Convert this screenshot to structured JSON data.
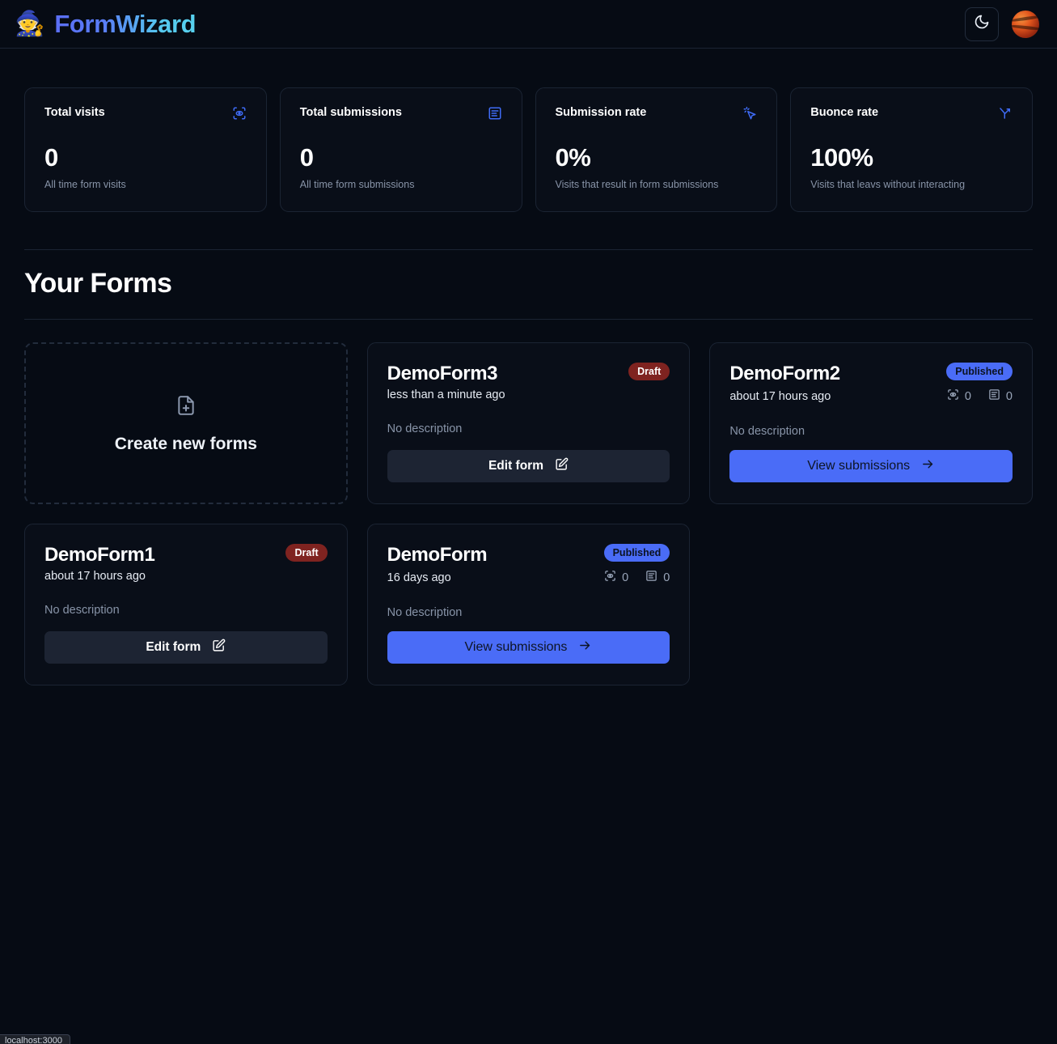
{
  "header": {
    "logo_emoji": "🧙",
    "brand": "FormWizard",
    "theme_toggle_icon": "moon-icon",
    "avatar_label": "user-avatar"
  },
  "stats": [
    {
      "title": "Total visits",
      "value": "0",
      "subtitle": "All time form visits",
      "icon": "eye-scan-icon"
    },
    {
      "title": "Total submissions",
      "value": "0",
      "subtitle": "All time form submissions",
      "icon": "form-input-icon"
    },
    {
      "title": "Submission rate",
      "value": "0%",
      "subtitle": "Visits that result in form submissions",
      "icon": "mouse-pointer-click-icon"
    },
    {
      "title": "Buonce rate",
      "value": "100%",
      "subtitle": "Visits that leavs without interacting",
      "icon": "arrow-branch-icon"
    }
  ],
  "section": {
    "title": "Your Forms"
  },
  "create_card": {
    "label": "Create new forms",
    "icon": "file-plus-icon"
  },
  "forms": [
    {
      "name": "DemoForm3",
      "badge": "Draft",
      "badge_type": "draft",
      "date": "less than a minute ago",
      "description": "No description",
      "action_label": "Edit form",
      "action_type": "secondary",
      "action_icon": "pencil-square-icon",
      "show_stats": false,
      "visits": "",
      "submissions": ""
    },
    {
      "name": "DemoForm2",
      "badge": "Published",
      "badge_type": "published",
      "date": "about 17 hours ago",
      "description": "No description",
      "action_label": "View submissions",
      "action_type": "primary",
      "action_icon": "arrow-right-icon",
      "show_stats": true,
      "visits": "0",
      "submissions": "0"
    },
    {
      "name": "DemoForm1",
      "badge": "Draft",
      "badge_type": "draft",
      "date": "about 17 hours ago",
      "description": "No description",
      "action_label": "Edit form",
      "action_type": "secondary",
      "action_icon": "pencil-square-icon",
      "show_stats": false,
      "visits": "",
      "submissions": ""
    },
    {
      "name": "DemoForm",
      "badge": "Published",
      "badge_type": "published",
      "date": "16 days ago",
      "description": "No description",
      "action_label": "View submissions",
      "action_type": "primary",
      "action_icon": "arrow-right-icon",
      "show_stats": true,
      "visits": "0",
      "submissions": "0"
    }
  ],
  "status_bar": {
    "text": "localhost:3000"
  },
  "colors": {
    "background": "#060b14",
    "card": "#090e18",
    "border": "#1b2433",
    "accent": "#4a6cf7",
    "draft": "#7f2320",
    "muted": "#8894a8"
  }
}
